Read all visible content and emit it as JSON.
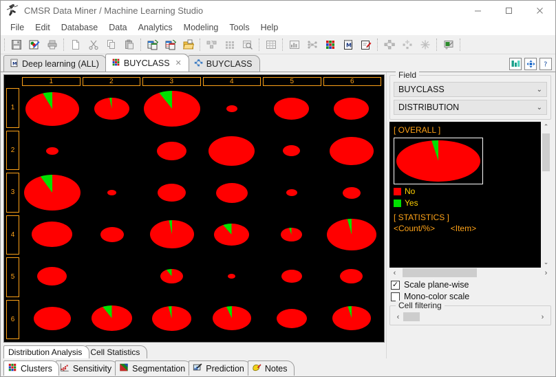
{
  "window": {
    "title": "CMSR Data Miner / Machine Learning Studio",
    "icon": "app-icon",
    "minimize": "—",
    "maximize": "☐",
    "close": "✕"
  },
  "menubar": {
    "items": [
      {
        "label": "File"
      },
      {
        "label": "Edit"
      },
      {
        "label": "Database"
      },
      {
        "label": "Data"
      },
      {
        "label": "Analytics"
      },
      {
        "label": "Modeling"
      },
      {
        "label": "Tools"
      },
      {
        "label": "Help"
      }
    ]
  },
  "toolbar": {
    "groups": [
      [
        "save-icon",
        "chart-edit-icon",
        "print-icon"
      ],
      [
        "new-document-icon",
        "cut-icon",
        "copy-icon",
        "paste-icon"
      ],
      [
        "copy-table-icon",
        "copy-table-red-icon",
        "open-folder-icon"
      ],
      [
        "query-icon",
        "grid-icon",
        "search-table-icon"
      ],
      [
        "spreadsheet-icon"
      ],
      [
        "table-chart-icon",
        "network-icon",
        "cluster-grid-icon",
        "model-icon",
        "notes-edit-icon"
      ],
      [
        "tree-icon",
        "tree-add-icon",
        "snowflake-icon"
      ],
      [
        "presentation-icon"
      ]
    ]
  },
  "tabs": {
    "items": [
      {
        "label": "Deep learning (ALL)",
        "icon": "model-icon",
        "active": false,
        "closable": false
      },
      {
        "label": "BUYCLASS",
        "icon": "cluster-grid-icon",
        "active": true,
        "closable": true
      },
      {
        "label": "BUYCLASS",
        "icon": "tree-icon",
        "active": false,
        "closable": false
      }
    ],
    "close_glyph": "✕",
    "right_icons": [
      "panel-layout-icon",
      "fit-to-window-icon",
      "help-icon"
    ]
  },
  "plot": {
    "column_headers": [
      "1",
      "2",
      "3",
      "4",
      "5",
      "6"
    ],
    "row_headers": [
      "1",
      "2",
      "3",
      "4",
      "5",
      "6"
    ],
    "background": "#000000",
    "header_color": "#ffa318"
  },
  "chart_data": {
    "type": "pie",
    "title": "BUYCLASS DISTRIBUTION",
    "grid": {
      "rows": 6,
      "cols": 6
    },
    "categories": [
      "No",
      "Yes"
    ],
    "colors": {
      "No": "#ff0000",
      "Yes": "#00e000"
    },
    "overall": {
      "label": "[ OVERALL ]",
      "values": [
        93,
        7
      ]
    },
    "cells": [
      {
        "row": 1,
        "col": 1,
        "size": 0.95,
        "values": [
          88,
          12
        ]
      },
      {
        "row": 1,
        "col": 2,
        "size": 0.62,
        "values": [
          95,
          5
        ]
      },
      {
        "row": 1,
        "col": 3,
        "size": 1.0,
        "values": [
          85,
          15
        ]
      },
      {
        "row": 1,
        "col": 4,
        "size": 0.2,
        "values": [
          100,
          0
        ]
      },
      {
        "row": 1,
        "col": 5,
        "size": 0.62,
        "values": [
          100,
          0
        ]
      },
      {
        "row": 1,
        "col": 6,
        "size": 0.62,
        "values": [
          100,
          0
        ]
      },
      {
        "row": 2,
        "col": 1,
        "size": 0.22,
        "values": [
          100,
          0
        ]
      },
      {
        "row": 2,
        "col": 2,
        "size": 0.0,
        "values": [
          100,
          0
        ]
      },
      {
        "row": 2,
        "col": 3,
        "size": 0.52,
        "values": [
          100,
          0
        ]
      },
      {
        "row": 2,
        "col": 4,
        "size": 0.82,
        "values": [
          100,
          0
        ]
      },
      {
        "row": 2,
        "col": 5,
        "size": 0.3,
        "values": [
          100,
          0
        ]
      },
      {
        "row": 2,
        "col": 6,
        "size": 0.78,
        "values": [
          100,
          0
        ]
      },
      {
        "row": 3,
        "col": 1,
        "size": 1.0,
        "values": [
          86,
          14
        ]
      },
      {
        "row": 3,
        "col": 2,
        "size": 0.16,
        "values": [
          100,
          0
        ]
      },
      {
        "row": 3,
        "col": 3,
        "size": 0.5,
        "values": [
          100,
          0
        ]
      },
      {
        "row": 3,
        "col": 4,
        "size": 0.56,
        "values": [
          100,
          0
        ]
      },
      {
        "row": 3,
        "col": 5,
        "size": 0.2,
        "values": [
          100,
          0
        ]
      },
      {
        "row": 3,
        "col": 6,
        "size": 0.32,
        "values": [
          100,
          0
        ]
      },
      {
        "row": 4,
        "col": 1,
        "size": 0.72,
        "values": [
          100,
          0
        ]
      },
      {
        "row": 4,
        "col": 2,
        "size": 0.42,
        "values": [
          100,
          0
        ]
      },
      {
        "row": 4,
        "col": 3,
        "size": 0.78,
        "values": [
          95,
          5
        ]
      },
      {
        "row": 4,
        "col": 4,
        "size": 0.62,
        "values": [
          84,
          16
        ]
      },
      {
        "row": 4,
        "col": 5,
        "size": 0.38,
        "values": [
          92,
          8
        ]
      },
      {
        "row": 4,
        "col": 6,
        "size": 0.88,
        "values": [
          94,
          6
        ]
      },
      {
        "row": 5,
        "col": 1,
        "size": 0.52,
        "values": [
          100,
          0
        ]
      },
      {
        "row": 5,
        "col": 2,
        "size": 0.0,
        "values": [
          100,
          0
        ]
      },
      {
        "row": 5,
        "col": 3,
        "size": 0.4,
        "values": [
          85,
          15
        ]
      },
      {
        "row": 5,
        "col": 4,
        "size": 0.13,
        "values": [
          100,
          0
        ]
      },
      {
        "row": 5,
        "col": 5,
        "size": 0.36,
        "values": [
          100,
          0
        ]
      },
      {
        "row": 5,
        "col": 6,
        "size": 0.4,
        "values": [
          100,
          0
        ]
      },
      {
        "row": 6,
        "col": 1,
        "size": 0.66,
        "values": [
          100,
          0
        ]
      },
      {
        "row": 6,
        "col": 2,
        "size": 0.72,
        "values": [
          85,
          15
        ]
      },
      {
        "row": 6,
        "col": 3,
        "size": 0.7,
        "values": [
          94,
          6
        ]
      },
      {
        "row": 6,
        "col": 4,
        "size": 0.68,
        "values": [
          90,
          10
        ]
      },
      {
        "row": 6,
        "col": 5,
        "size": 0.54,
        "values": [
          100,
          0
        ]
      },
      {
        "row": 6,
        "col": 6,
        "size": 0.68,
        "values": [
          93,
          7
        ]
      }
    ]
  },
  "field_panel": {
    "group_label": "Field",
    "field_value": "BUYCLASS",
    "mode_value": "DISTRIBUTION",
    "caret": "⌄"
  },
  "detail_panel": {
    "overall_label": "[ OVERALL ]",
    "legend": [
      {
        "label": "No",
        "color": "#ff0000"
      },
      {
        "label": "Yes",
        "color": "#00e000"
      }
    ],
    "statistics_label": "[ STATISTICS ]",
    "statistics_header_left": "<Count/%>",
    "statistics_header_right": "<Item>",
    "scroll_up": "⌃",
    "scroll_down": "⌄",
    "scroll_left": "‹",
    "scroll_right": "›"
  },
  "options": {
    "scale_plane_wise": {
      "label": "Scale plane-wise",
      "checked": true,
      "glyph": "✓"
    },
    "mono_color_scale": {
      "label": "Mono-color scale",
      "checked": false,
      "glyph": ""
    },
    "cell_filtering": {
      "label": "Cell filtering",
      "left_arrow": "‹",
      "right_arrow": "›"
    }
  },
  "sub_tabs": {
    "items": [
      {
        "label": "Distribution Analysis",
        "active": true
      },
      {
        "label": "Cell Statistics",
        "active": false
      }
    ]
  },
  "bottom_tabs": {
    "items": [
      {
        "label": "Clusters",
        "icon": "cluster-grid-icon",
        "active": true
      },
      {
        "label": "Sensitivity",
        "icon": "sensitivity-icon",
        "active": false
      },
      {
        "label": "Segmentation",
        "icon": "segmentation-icon",
        "active": false
      },
      {
        "label": "Prediction",
        "icon": "prediction-icon",
        "active": false
      },
      {
        "label": "Notes",
        "icon": "notes-icon",
        "active": false
      }
    ]
  }
}
